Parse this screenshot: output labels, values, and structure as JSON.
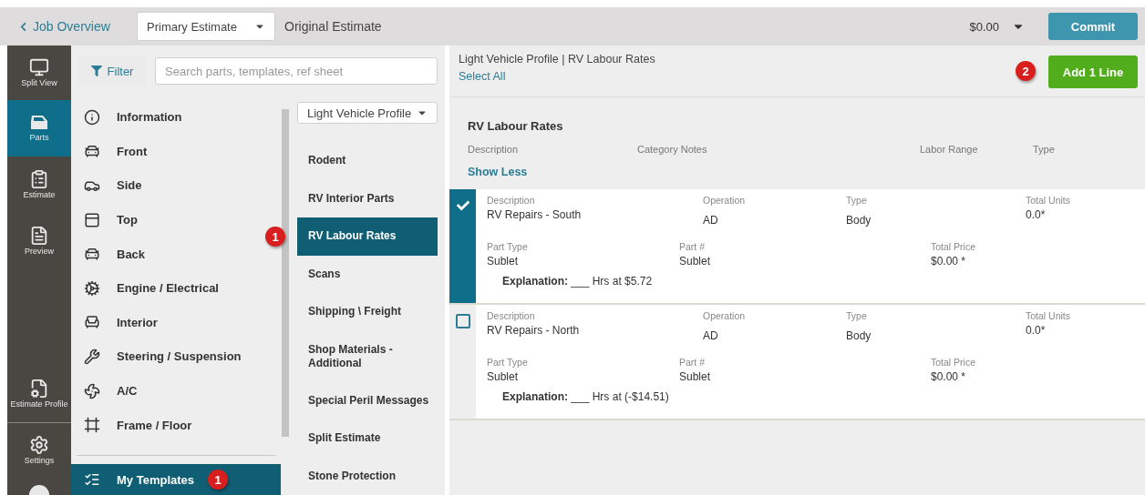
{
  "top_bar": {
    "back_link": "Job Overview",
    "estimate_select": "Primary Estimate",
    "estimate_name": "Original Estimate",
    "total": "$0.00",
    "commit_button": "Commit"
  },
  "rail": [
    {
      "label": "Split View",
      "selected": false
    },
    {
      "label": "Parts",
      "selected": true
    },
    {
      "label": "Estimate",
      "selected": false
    },
    {
      "label": "Preview",
      "selected": false
    },
    {
      "label": "Estimate Profile",
      "selected": false
    },
    {
      "label": "Settings",
      "selected": false
    }
  ],
  "toolbar": {
    "filter_button": "Filter",
    "search": {
      "placeholder": "Search parts, templates, ref sheet"
    }
  },
  "categories": [
    {
      "label": "Information",
      "selected": false
    },
    {
      "label": "Front",
      "selected": false
    },
    {
      "label": "Side",
      "selected": false
    },
    {
      "label": "Top",
      "selected": false
    },
    {
      "label": "Back",
      "selected": false
    },
    {
      "label": "Engine / Electrical",
      "selected": false
    },
    {
      "label": "Interior",
      "selected": false
    },
    {
      "label": "Steering / Suspension",
      "selected": false
    },
    {
      "label": "A/C",
      "selected": false
    },
    {
      "label": "Frame / Floor",
      "selected": false
    }
  ],
  "my_templates": {
    "label": "My Templates",
    "selected": true,
    "badge": "1"
  },
  "profile_select": "Light Vehicle Profile",
  "subcategories": [
    {
      "label": "Rodent",
      "selected": false
    },
    {
      "label": "RV Interior Parts",
      "selected": false
    },
    {
      "label": "RV Labour Rates",
      "selected": true,
      "badge": "1"
    },
    {
      "label": "Scans",
      "selected": false
    },
    {
      "label": "Shipping \\ Freight",
      "selected": false
    },
    {
      "label": "Shop Materials - Additional",
      "selected": false
    },
    {
      "label": "Special Peril Messages",
      "selected": false
    },
    {
      "label": "Split Estimate",
      "selected": false
    },
    {
      "label": "Stone Protection",
      "selected": false
    }
  ],
  "main": {
    "breadcrumb": "Light Vehicle Profile | RV Labour Rates",
    "select_all": "Select All",
    "add_button": "Add 1 Line",
    "add_badge": "2"
  },
  "section": {
    "title": "RV Labour Rates",
    "columns": [
      "Description",
      "Category Notes",
      "Labor Range",
      "Type"
    ],
    "show_less": "Show Less"
  },
  "lines": [
    {
      "checked": true,
      "top": [
        {
          "label": "Description",
          "value": "RV Repairs - South"
        },
        {
          "label": "Operation",
          "value": "AD"
        },
        {
          "label": "Type",
          "value": "Body"
        },
        {
          "label": "Total Units",
          "value": "0.0*"
        }
      ],
      "bottom": [
        {
          "label": "Part Type",
          "value": "Sublet"
        },
        {
          "label": "Part #",
          "value": "Sublet"
        },
        {
          "label": "Total Price",
          "value": "$0.00 *"
        }
      ],
      "explanation": "**Explanation:** ___ Hrs at $5.72"
    },
    {
      "checked": false,
      "top": [
        {
          "label": "Description",
          "value": "RV Repairs - North"
        },
        {
          "label": "Operation",
          "value": "AD"
        },
        {
          "label": "Type",
          "value": "Body"
        },
        {
          "label": "Total Units",
          "value": "0.0*"
        }
      ],
      "bottom": [
        {
          "label": "Part Type",
          "value": "Sublet"
        },
        {
          "label": "Part #",
          "value": "Sublet"
        },
        {
          "label": "Total Price",
          "value": "$0.00 *"
        }
      ],
      "explanation": "**Explanation:** ___ Hrs at (-$14.51)"
    }
  ]
}
